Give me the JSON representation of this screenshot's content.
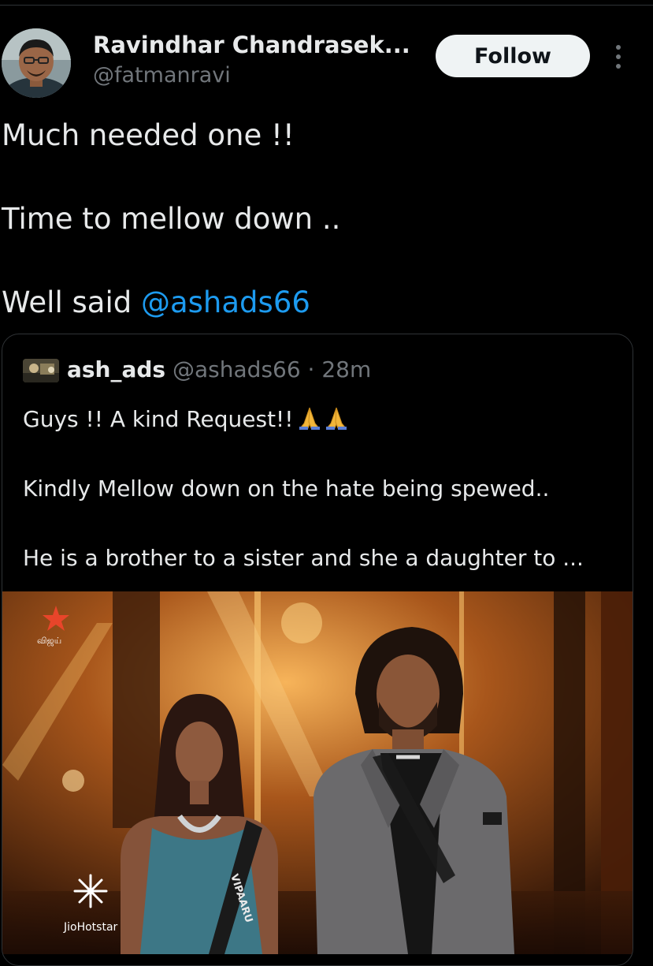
{
  "author": {
    "display_name": "Ravindhar Chandrasek...",
    "handle": "@fatmanravi",
    "avatar_icon": "profile-photo",
    "follow_label": "Follow",
    "more_icon": "more-vertical-icon"
  },
  "post": {
    "line1": "Much needed one !!",
    "line2": "Time to mellow down ..",
    "line3_prefix": "Well said ",
    "line3_mention": "@ashads66"
  },
  "quote": {
    "display_name": "ash_ads",
    "handle": "@ashads66",
    "separator": " · ",
    "time": "28m",
    "line1": "Guys !! A kind Request!!",
    "line2": "Kindly Mellow down on the hate being spewed..",
    "line3": "He is a brother to a sister and she a daughter to ...",
    "emoji_icon": "folded-hands-icon",
    "media": {
      "channel_logo_text": "விஜய்",
      "watermark": "JioHotstar",
      "sash_text": "VIPAARU"
    }
  },
  "colors": {
    "background": "#000000",
    "text": "#e7e9ea",
    "muted": "#71767b",
    "link": "#1d9bf0",
    "border": "#2f3336",
    "follow_bg": "#eff3f4"
  }
}
